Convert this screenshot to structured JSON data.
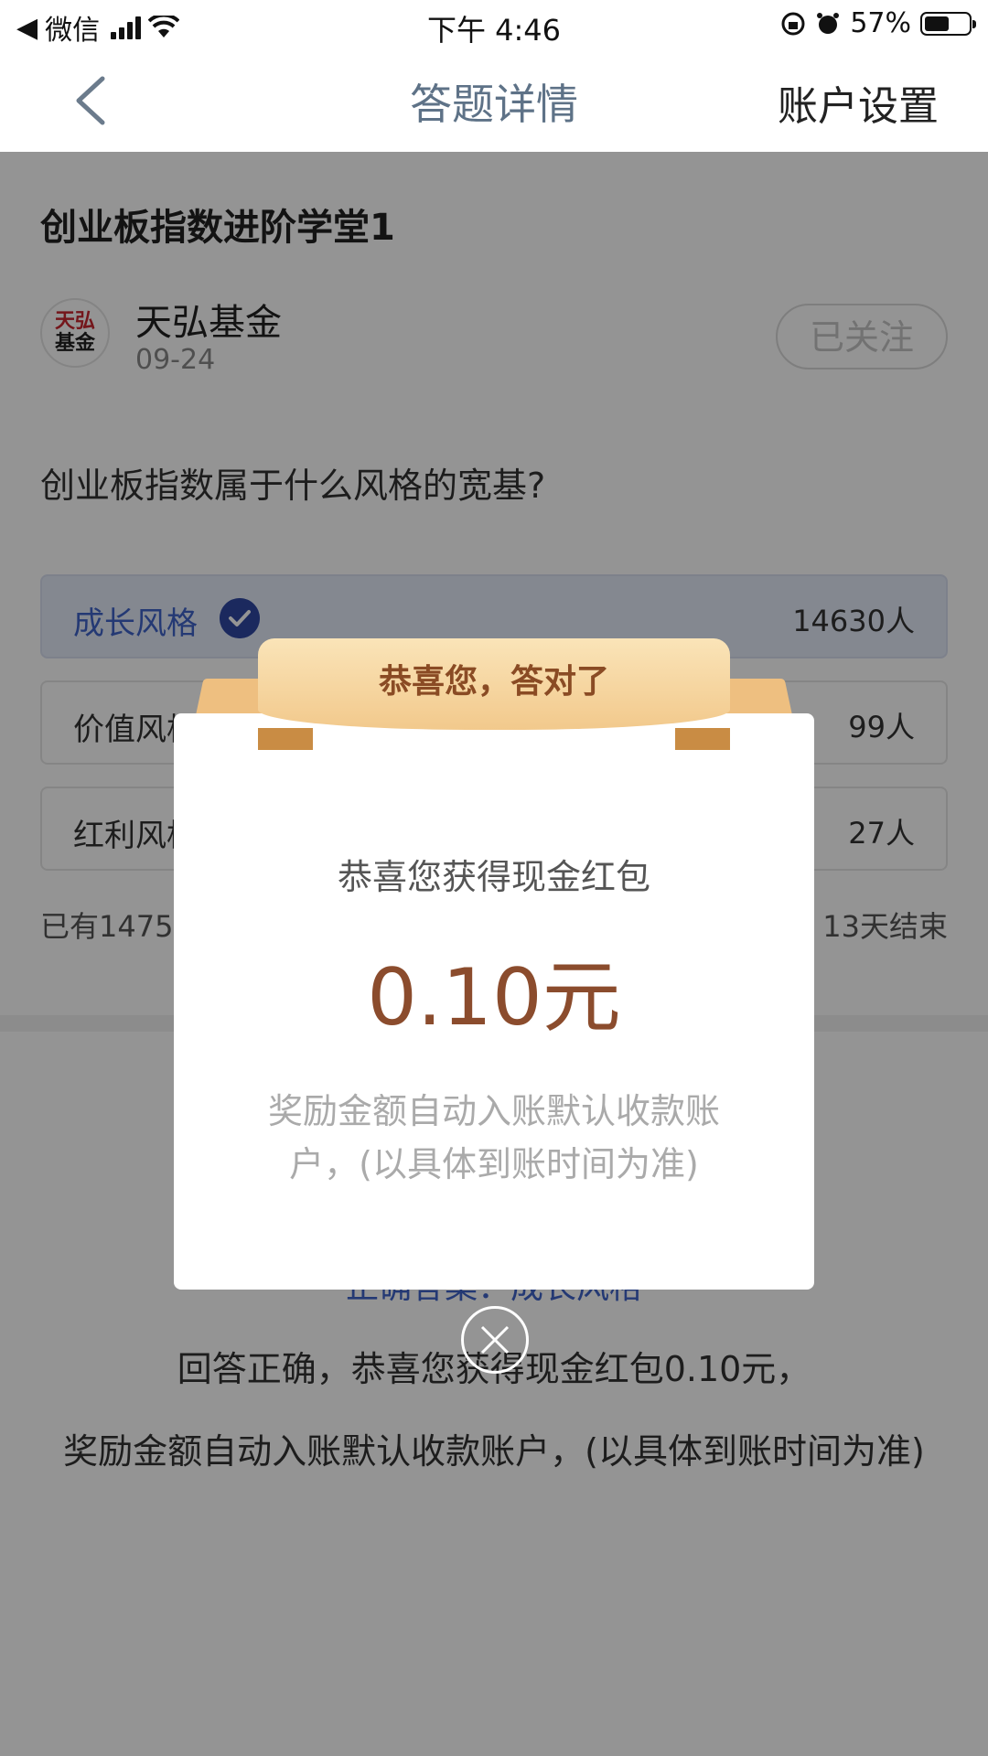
{
  "status_bar": {
    "carrier": "微信",
    "time": "下午 4:46",
    "battery_text": "57%",
    "battery_level": 0.57
  },
  "nav": {
    "title": "答题详情",
    "settings_label": "账户设置"
  },
  "quiz": {
    "title": "创业板指数进阶学堂1",
    "publisher": {
      "name": "天弘基金",
      "logo_line1": "天弘",
      "logo_line2": "基金",
      "date": "09-24"
    },
    "follow_label": "已关注",
    "question": "创业板指数属于什么风格的宽基?",
    "options": [
      {
        "label": "成长风格",
        "count": "14630人",
        "selected": true
      },
      {
        "label": "价值风格",
        "count": "99人",
        "selected": false
      },
      {
        "label": "红利风格",
        "count": "27人",
        "selected": false
      }
    ],
    "summary_left": "已有1475",
    "summary_right": "13天结束",
    "answer_text": "正确答案：成长风格",
    "result_line1": "回答正确，恭喜您获得现金红包0.10元，",
    "result_line2": "奖励金额自动入账默认收款账户，(以具体到账时间为准)"
  },
  "modal": {
    "ribbon_text": "恭喜您，答对了",
    "subtitle": "恭喜您获得现金红包",
    "amount": "0.10元",
    "note": "奖励金额自动入账默认收款账户，(以具体到账时间为准)"
  },
  "colors": {
    "accent_blue": "#3f63c8",
    "amount_brown": "#8b4c2d",
    "ribbon_gold": "#f2c98c"
  }
}
